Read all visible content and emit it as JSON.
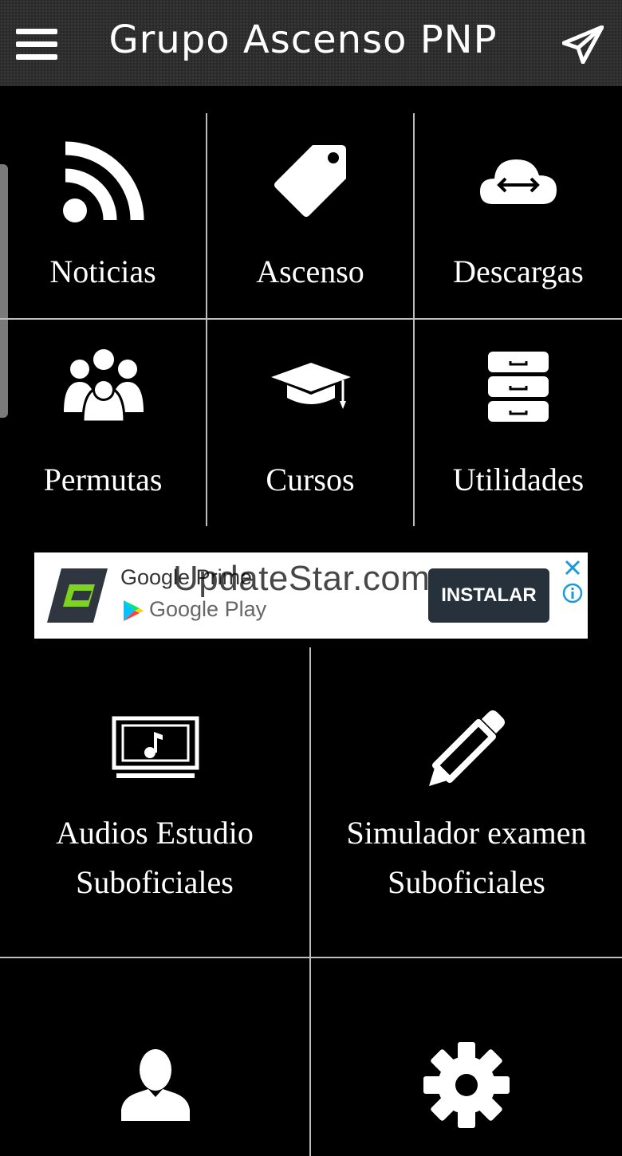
{
  "app": {
    "title": "Grupo Ascenso PNP"
  },
  "menu": {
    "noticias": "Noticias",
    "ascenso": "Ascenso",
    "descargas": "Descargas",
    "permutas": "Permutas",
    "cursos": "Cursos",
    "utilidades": "Utilidades",
    "audios_line1": "Audios Estudio",
    "audios_line2": "Suboficiales",
    "simulador_line1": "Simulador examen",
    "simulador_line2": "Suboficiales"
  },
  "ad": {
    "title": "Google Prime",
    "store": "Google Play",
    "cta": "INSTALAR",
    "watermark": "UpdateStar.com"
  },
  "icons": {
    "menu": "hamburger-icon",
    "send": "send-icon",
    "noticias": "rss-icon",
    "ascenso": "tag-icon",
    "descargas": "cloud-transfer-icon",
    "permutas": "group-icon",
    "cursos": "graduation-cap-icon",
    "utilidades": "drawers-icon",
    "audios": "music-monitor-icon",
    "simulador": "pencil-icon",
    "profile": "user-icon",
    "settings": "gear-icon"
  },
  "colors": {
    "background": "#000000",
    "appbar": "#2b2b2b",
    "divider": "#bdbdbd",
    "ad_button": "#27313b"
  }
}
